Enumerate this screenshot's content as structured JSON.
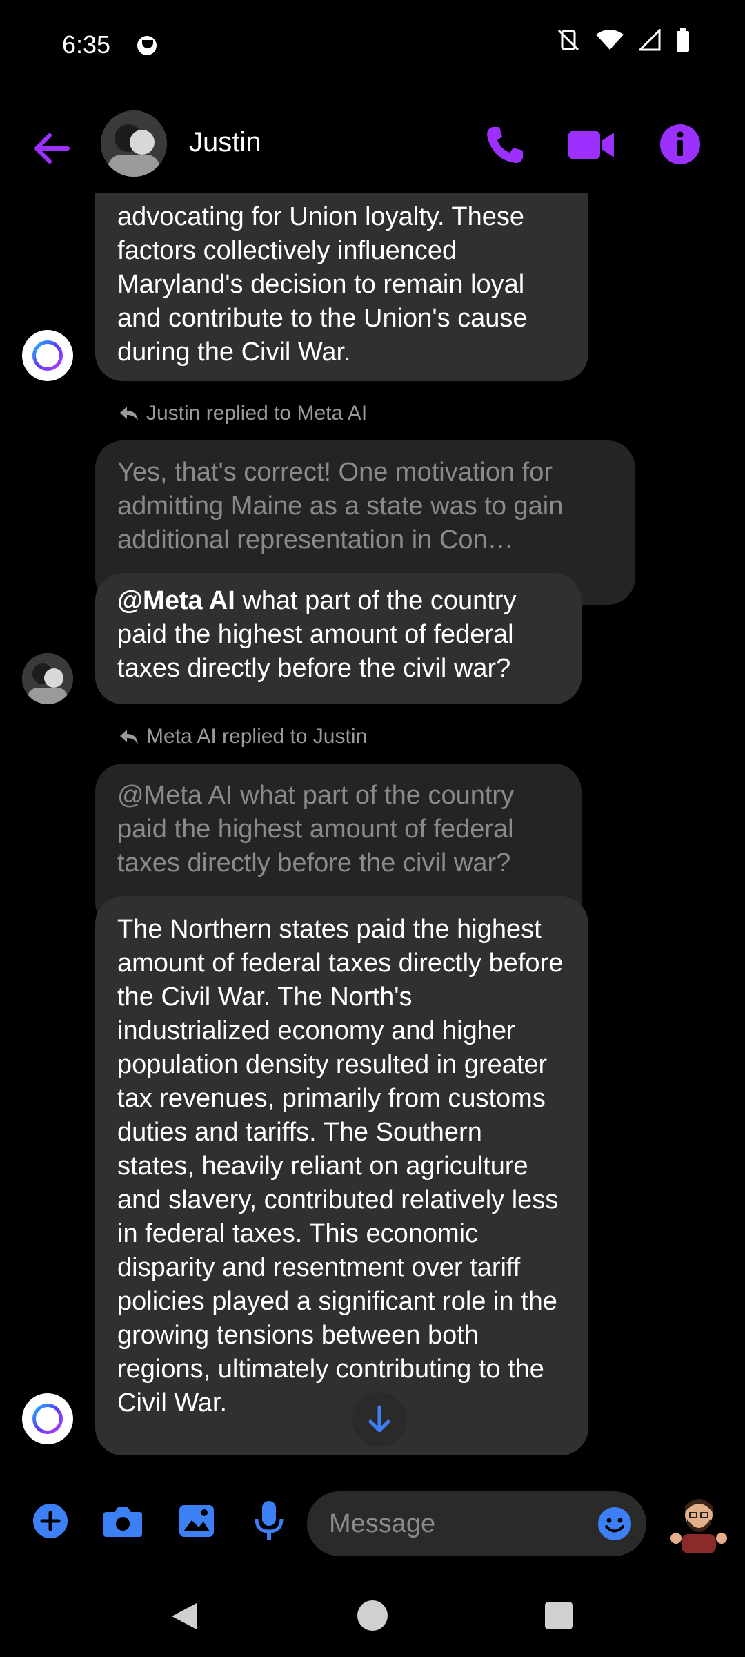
{
  "status": {
    "time": "6:35"
  },
  "header": {
    "contact_name": "Justin"
  },
  "colors": {
    "accent": "#9b30ff",
    "composer_blue": "#3d7ff5",
    "bubble": "#303030",
    "quoted_bubble": "#242424"
  },
  "messages": {
    "ai_answer_1": "advocating for Union loyalty. These factors collectively influenced Maryland's decision to remain loyal and contribute to the Union's cause during the Civil War.",
    "reply_1_meta": "Justin replied to Meta AI",
    "reply_1_quote": "Yes, that's correct! One motivation for admitting Maine as a state was to gain additional representation in Con…",
    "user_msg_mention": "@Meta AI",
    "user_msg_text": " what part of the country paid the highest amount of federal taxes directly before the civil war?",
    "reply_2_meta": "Meta AI replied to Justin",
    "reply_2_quote": "@Meta AI what part of the country paid the highest amount of federal taxes directly before the civil war?",
    "ai_answer_2": "The Northern states paid the highest amount of federal taxes directly before the Civil War. The North's industrialized economy and higher population density resulted in greater tax revenues, primarily from customs duties and tariffs. The Southern states, heavily reliant on agriculture and slavery, contributed relatively less in federal taxes. This economic disparity and resentment over tariff policies played a significant role in the growing tensions between both regions, ultimately contributing to the Civil War."
  },
  "composer": {
    "placeholder": "Message"
  },
  "icons": [
    "back-arrow-icon",
    "phone-icon",
    "video-camera-icon",
    "info-icon",
    "plus-icon",
    "camera-icon",
    "image-icon",
    "microphone-icon",
    "emoji-icon",
    "arrow-down-icon"
  ]
}
